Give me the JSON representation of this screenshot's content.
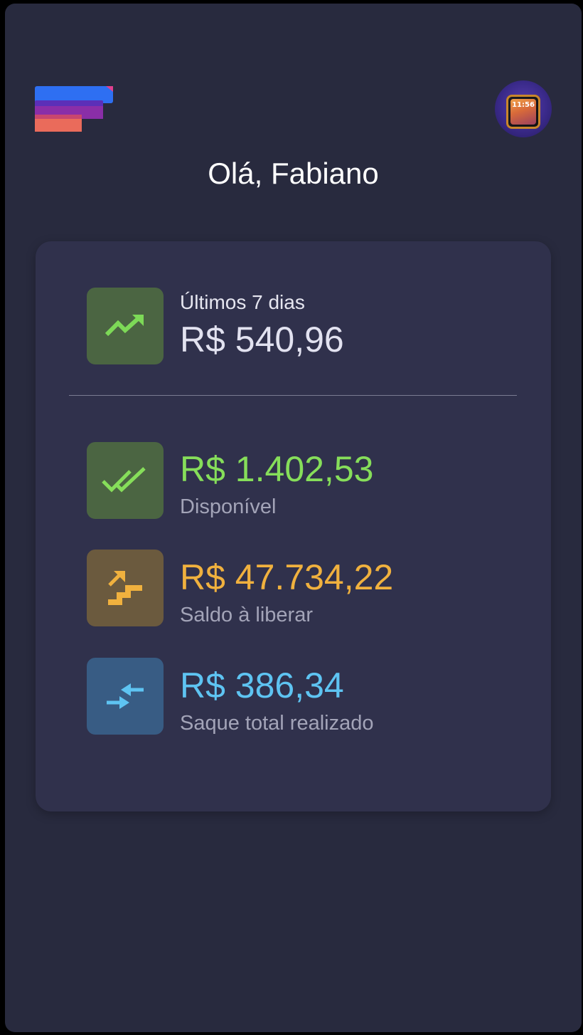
{
  "header": {
    "greeting": "Olá, Fabiano",
    "logo_icon": "stacked-bars-logo",
    "avatar_icon": "device-clock-avatar",
    "avatar_time": "11:56"
  },
  "summary": {
    "label": "Últimos 7 dias",
    "value": "R$ 540,96",
    "icon": "trending-up-icon",
    "color": "#7dd957"
  },
  "stats": [
    {
      "value": "R$ 1.402,53",
      "label": "Disponível",
      "icon": "double-check-icon",
      "color": "#86de5a"
    },
    {
      "value": "R$ 47.734,22",
      "label": "Saldo à liberar",
      "icon": "stairs-up-icon",
      "color": "#f0b13e"
    },
    {
      "value": "R$ 386,34",
      "label": "Saque total realizado",
      "icon": "arrows-inward-icon",
      "color": "#5ec4f2"
    }
  ],
  "colors": {
    "background": "#282a3e",
    "card": "#30314c",
    "logo_blue": "#2e6ff2",
    "logo_purple": "#7d2bb0",
    "logo_coral": "#e86a5a"
  }
}
